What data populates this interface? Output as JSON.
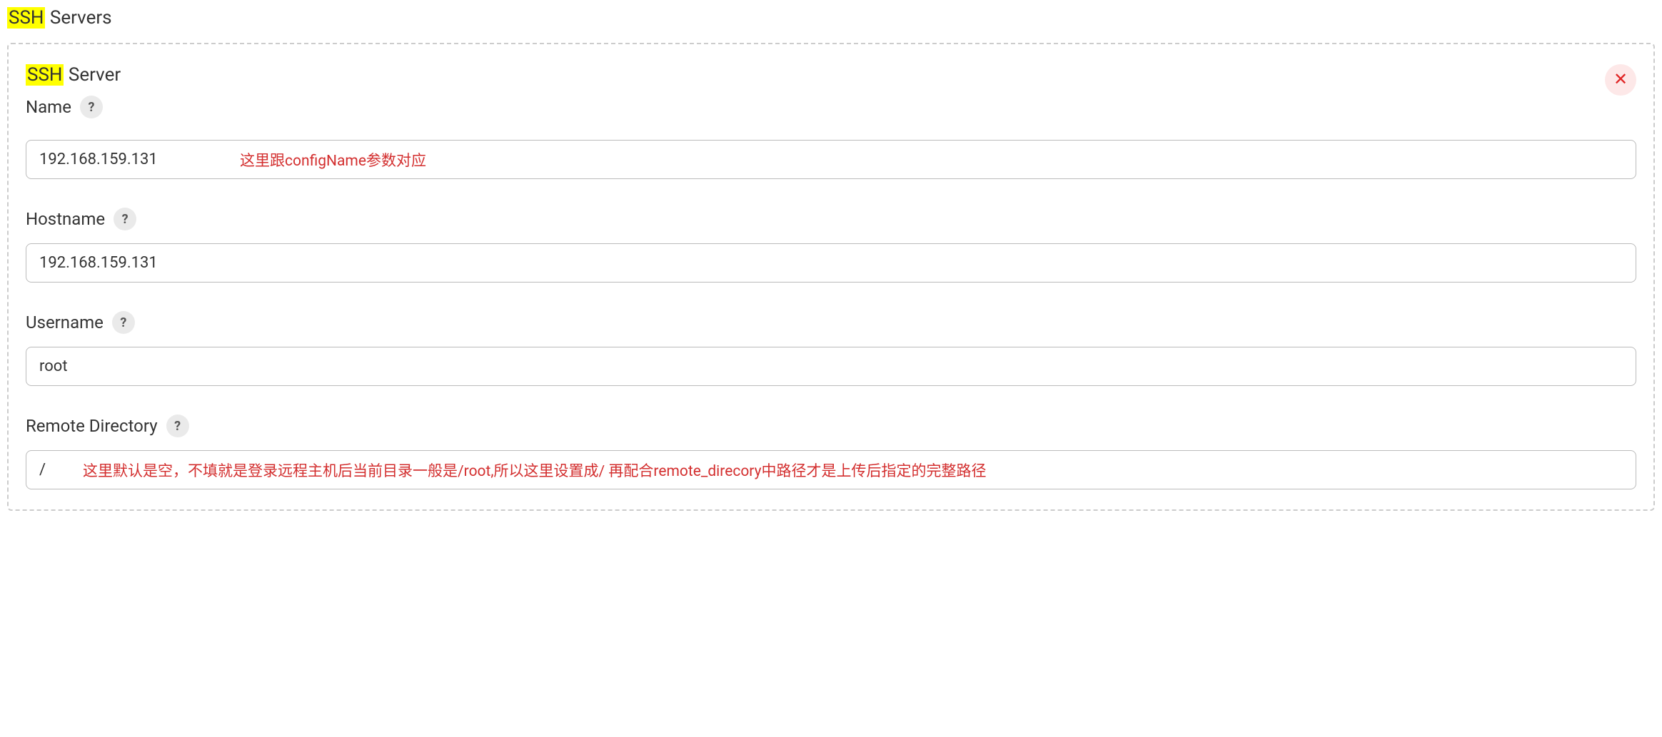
{
  "section": {
    "title_highlight": "SSH",
    "title_rest": " Servers"
  },
  "box": {
    "title_highlight": "SSH",
    "title_rest": " Server"
  },
  "fields": {
    "name": {
      "label": "Name",
      "value": "192.168.159.131",
      "annotation": "这里跟configName参数对应"
    },
    "hostname": {
      "label": "Hostname",
      "value": "192.168.159.131"
    },
    "username": {
      "label": "Username",
      "value": "root"
    },
    "remote_directory": {
      "label": "Remote Directory",
      "value": "/",
      "annotation": "这里默认是空，不填就是登录远程主机后当前目录一般是/root,所以这里设置成/ 再配合remote_direcory中路径才是上传后指定的完整路径"
    }
  },
  "help_char": "?",
  "close_char": "✕"
}
